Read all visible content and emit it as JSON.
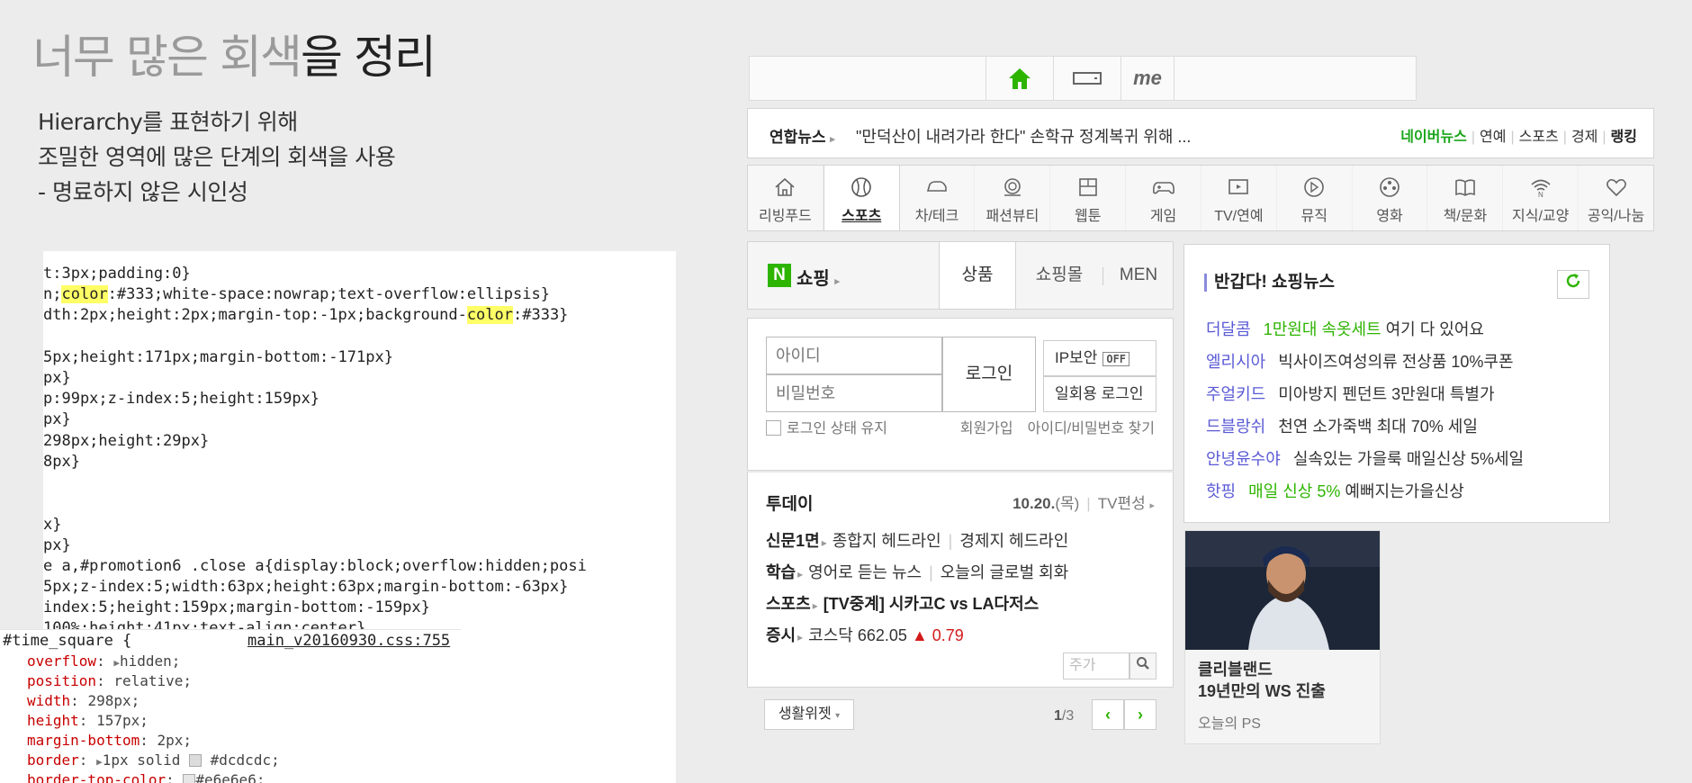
{
  "slide": {
    "title_grey": "너무 많은 회색",
    "title_dark": "을 정리",
    "desc": [
      "Hierarchy를 표현하기 위해",
      "조밀한 영역에 많은 단계의 회색을 사용",
      "- 명료하지 않은 시인성"
    ]
  },
  "code": {
    "lines": [
      {
        "pre": "t:3px;padding:0}",
        "hl": "",
        "post": ""
      },
      {
        "pre": "n;",
        "hl": "color",
        "post": ":#333;white-space:nowrap;text-overflow:ellipsis}"
      },
      {
        "pre": "dth:2px;height:2px;margin-top:-1px;background-",
        "hl": "color",
        "post": ":#333}"
      },
      {
        "pre": "5px;height:171px;margin-bottom:-171px}",
        "hl": "",
        "post": ""
      },
      {
        "pre": "px}",
        "hl": "",
        "post": ""
      },
      {
        "pre": "p:99px;z-index:5;height:159px}",
        "hl": "",
        "post": ""
      },
      {
        "pre": "px}",
        "hl": "",
        "post": ""
      },
      {
        "pre": "298px;height:29px}",
        "hl": "",
        "post": ""
      },
      {
        "pre": "8px}",
        "hl": "",
        "post": ""
      },
      {
        "pre": "x}",
        "hl": "",
        "post": ""
      },
      {
        "pre": "px}",
        "hl": "",
        "post": ""
      },
      {
        "pre": "e a,#promotion6 .close a{display:block;overflow:hidden;posi",
        "hl": "",
        "post": ""
      },
      {
        "pre": "5px;z-index:5;width:63px;height:63px;margin-bottom:-63px}",
        "hl": "",
        "post": ""
      },
      {
        "pre": "index:5;height:159px;margin-bottom:-159px}",
        "hl": "",
        "post": ""
      },
      {
        "pre": "100%;height:41px;text-align:center}",
        "hl": "",
        "post": ""
      }
    ],
    "inspector": {
      "selector": "#time_square {",
      "source": "main_v20160930.css:755",
      "props": [
        {
          "name": "overflow",
          "value": "hidden;",
          "arrow": "▶"
        },
        {
          "name": "position",
          "value": "relative;",
          "arrow": ""
        },
        {
          "name": "width",
          "value": "298px;",
          "arrow": ""
        },
        {
          "name": "height",
          "value": "157px;",
          "arrow": ""
        },
        {
          "name": "margin-bottom",
          "value": "2px;",
          "arrow": ""
        },
        {
          "name": "border",
          "value": "1px solid #dcdcdc;",
          "arrow": "▶",
          "swatch": "#dcdcdc"
        },
        {
          "name": "border-top-color",
          "value": "#e6e6e6;",
          "arrow": "",
          "swatch": "#e6e6e6"
        }
      ]
    }
  },
  "naver": {
    "top_icons": [
      "home-icon",
      "tablet-icon",
      "me-icon"
    ],
    "top_me_label": "me",
    "news": {
      "press": "연합뉴스",
      "headline": "\"만덕산이 내려가라 한다\" 손학규 정계복귀 위해 ...",
      "links": [
        "네이버뉴스",
        "연예",
        "스포츠",
        "경제",
        "랭킹"
      ]
    },
    "categories": [
      {
        "label": "리빙푸드",
        "icon": "home-icon",
        "active": false
      },
      {
        "label": "스포츠",
        "icon": "baseball-icon",
        "active": true
      },
      {
        "label": "차/테크",
        "icon": "car-icon",
        "active": false
      },
      {
        "label": "패션뷰티",
        "icon": "ring-icon",
        "active": false
      },
      {
        "label": "웹툰",
        "icon": "webtoon-icon",
        "active": false
      },
      {
        "label": "게임",
        "icon": "gamepad-icon",
        "active": false
      },
      {
        "label": "TV/연예",
        "icon": "tv-icon",
        "active": false
      },
      {
        "label": "뮤직",
        "icon": "play-icon",
        "active": false
      },
      {
        "label": "영화",
        "icon": "film-reel-icon",
        "active": false
      },
      {
        "label": "책/문화",
        "icon": "book-icon",
        "active": false
      },
      {
        "label": "지식/교양",
        "icon": "wifi-icon",
        "active": false
      },
      {
        "label": "공익/나눔",
        "icon": "heart-icon",
        "active": false
      }
    ],
    "shopping": {
      "logo": "N",
      "label": "쇼핑",
      "tabs": [
        "상품",
        "쇼핑몰",
        "MEN"
      ]
    },
    "login": {
      "id_placeholder": "아이디",
      "pw_placeholder": "비밀번호",
      "login_button": "로그인",
      "ip_security": "IP보안",
      "ip_off": "OFF",
      "one_time": "일회용 로그인",
      "keep_login": "로그인 상태 유지",
      "signup": "회원가입",
      "find": "아이디/비밀번호 찾기"
    },
    "today": {
      "title": "투데이",
      "date": "10.20.",
      "weekday": "(목)",
      "tv_schedule": "TV편성",
      "rows": [
        {
          "tag": "신문1면",
          "items": [
            "종합지 헤드라인",
            "경제지 헤드라인"
          ]
        },
        {
          "tag": "학습",
          "items": [
            "영어로 듣는 뉴스",
            "오늘의 글로벌 회화"
          ]
        },
        {
          "tag": "스포츠",
          "items": [
            "[TV중계] 시카고C vs LA다저스"
          ]
        }
      ],
      "stock_tag": "증시",
      "stock_name": "코스닥",
      "stock_value": "662.05",
      "stock_change": "▲ 0.79",
      "stock_search_placeholder": "주가",
      "widget_button": "생활위젯",
      "pager_current": "1",
      "pager_total": "/3"
    },
    "shop_news": {
      "title": "반갑다! 쇼핑뉴스",
      "rows": [
        {
          "brand": "더달콤",
          "highlight": "1만원대 속옷세트",
          "text": " 여기 다 있어요"
        },
        {
          "brand": "엘리시아",
          "highlight": "",
          "text": "빅사이즈여성의류 전상품 10%쿠폰"
        },
        {
          "brand": "주얼키드",
          "highlight": "",
          "text": "미아방지 펜던트 3만원대 특별가"
        },
        {
          "brand": "드블랑쉬",
          "highlight": "",
          "text": "천연 소가죽백 최대 70% 세일"
        },
        {
          "brand": "안녕윤수야",
          "highlight": "",
          "text": "실속있는 가을룩 매일신상 5%세일"
        },
        {
          "brand": "핫핑",
          "highlight": "매일 신상 5%",
          "text": " 예뻐지는가을신상"
        }
      ]
    },
    "photo_news": {
      "caption_line1": "클리블랜드",
      "caption_line2": "19년만의 WS 진출",
      "source": "오늘의 PS"
    },
    "colors": {
      "naver_green": "#2db400",
      "brand_purple": "#5a5ad6",
      "stock_red": "#d41b1b"
    }
  }
}
